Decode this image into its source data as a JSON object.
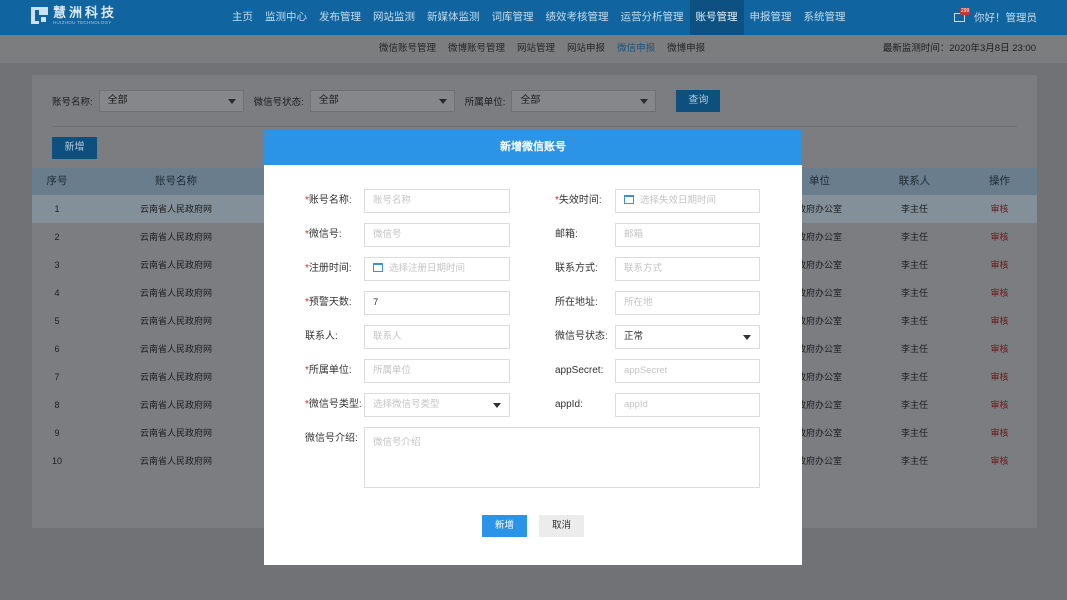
{
  "brand": {
    "name_cn": "慧洲科技",
    "name_en": "HUIZHOU TECHNOLOGY"
  },
  "nav": [
    "主页",
    "监测中心",
    "发布管理",
    "网站监测",
    "新媒体监测",
    "词库管理",
    "绩效考核管理",
    "运营分析管理",
    "账号管理",
    "申报管理",
    "系统管理"
  ],
  "nav_active": "账号管理",
  "user": {
    "mail_badge": "299",
    "greeting": "你好！管理员"
  },
  "subnav": [
    "微信账号管理",
    "微博账号管理",
    "网站管理",
    "网站申报",
    "微信申报",
    "微博申报"
  ],
  "subnav_active": "微信申报",
  "latest_monitor": "最新监测时间：2020年3月8日 23:00",
  "filters": {
    "account_name_label": "账号名称:",
    "account_name_value": "全部",
    "status_label": "微信号状态:",
    "status_value": "全部",
    "unit_label": "所属单位:",
    "unit_value": "全部",
    "query_button": "查询"
  },
  "add_button": "新增",
  "table": {
    "headers": [
      "序号",
      "账号名称",
      "",
      "单位",
      "联系人",
      "操作"
    ],
    "rows": [
      {
        "no": "1",
        "name": "云南省人民政府网",
        "unit": "政府办公室",
        "contact": "李主任",
        "op": "审核"
      },
      {
        "no": "2",
        "name": "云南省人民政府网",
        "unit": "政府办公室",
        "contact": "李主任",
        "op": "审核"
      },
      {
        "no": "3",
        "name": "云南省人民政府网",
        "unit": "政府办公室",
        "contact": "李主任",
        "op": "审核"
      },
      {
        "no": "4",
        "name": "云南省人民政府网",
        "unit": "政府办公室",
        "contact": "李主任",
        "op": "审核"
      },
      {
        "no": "5",
        "name": "云南省人民政府网",
        "unit": "政府办公室",
        "contact": "李主任",
        "op": "审核"
      },
      {
        "no": "6",
        "name": "云南省人民政府网",
        "unit": "政府办公室",
        "contact": "李主任",
        "op": "审核"
      },
      {
        "no": "7",
        "name": "云南省人民政府网",
        "unit": "政府办公室",
        "contact": "李主任",
        "op": "审核"
      },
      {
        "no": "8",
        "name": "云南省人民政府网",
        "unit": "政府办公室",
        "contact": "李主任",
        "op": "审核"
      },
      {
        "no": "9",
        "name": "云南省人民政府网",
        "unit": "政府办公室",
        "contact": "李主任",
        "op": "审核"
      },
      {
        "no": "10",
        "name": "云南省人民政府网",
        "unit": "政府办公室",
        "contact": "李主任",
        "op": "审核"
      }
    ]
  },
  "modal": {
    "title": "新增微信账号",
    "required_mark": "*",
    "fields": {
      "account_name": {
        "label": "账号名称:",
        "placeholder": "账号名称"
      },
      "expire_time": {
        "label": "失效时间:",
        "placeholder": "选择失效日期时间"
      },
      "wechat_id": {
        "label": "微信号:",
        "placeholder": "微信号"
      },
      "email": {
        "label": "邮箱:",
        "placeholder": "邮箱"
      },
      "register_time": {
        "label": "注册时间:",
        "placeholder": "选择注册日期时间"
      },
      "contact_method": {
        "label": "联系方式:",
        "placeholder": "联系方式"
      },
      "warning_days": {
        "label": "预警天数:",
        "value": "7"
      },
      "address": {
        "label": "所在地址:",
        "placeholder": "所在地"
      },
      "contact_person": {
        "label": "联系人:",
        "placeholder": "联系人"
      },
      "wechat_status": {
        "label": "微信号状态:",
        "value": "正常"
      },
      "unit": {
        "label": "所属单位:",
        "placeholder": "所属单位"
      },
      "app_secret": {
        "label": "appSecret:",
        "placeholder": "appSecret"
      },
      "wechat_type": {
        "label": "微信号类型:",
        "placeholder": "选择微信号类型"
      },
      "app_id": {
        "label": "appId:",
        "placeholder": "appId"
      },
      "intro": {
        "label": "微信号介绍:",
        "placeholder": "微信号介绍"
      }
    },
    "ok_button": "新增",
    "cancel_button": "取消"
  },
  "colors": {
    "primary": "#2b94e6",
    "nav_bg": "#10649f",
    "required": "#e1281e"
  },
  "icons": [
    "mail-icon",
    "calendar-icon",
    "chevron-down-icon"
  ]
}
